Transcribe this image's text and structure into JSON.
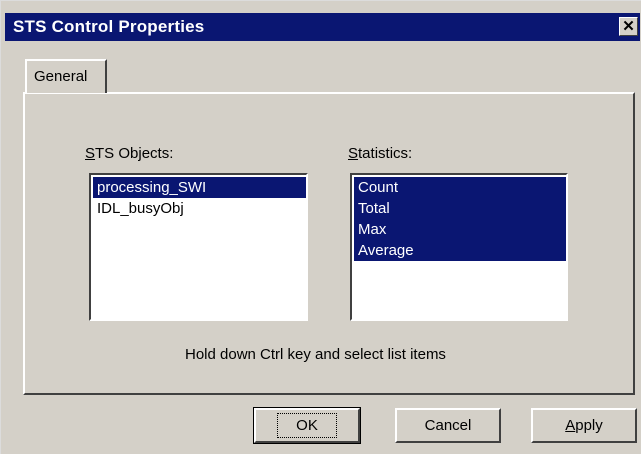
{
  "window": {
    "title": "STS Control Properties",
    "close_glyph": "✕"
  },
  "tabs": [
    {
      "label": "General",
      "active": true
    }
  ],
  "sts_objects": {
    "label": "STS Objects:",
    "label_accel": "S",
    "label_rest": "TS Objects:",
    "items": [
      {
        "label": "processing_SWI",
        "selected": true
      },
      {
        "label": "IDL_busyObj",
        "selected": false
      }
    ]
  },
  "statistics": {
    "label": "Statistics:",
    "label_accel": "S",
    "label_rest": "tatistics:",
    "items": [
      {
        "label": "Count",
        "selected": true
      },
      {
        "label": "Total",
        "selected": true
      },
      {
        "label": "Max",
        "selected": true
      },
      {
        "label": "Average",
        "selected": true
      }
    ]
  },
  "hint_text": "Hold down Ctrl key and select list items",
  "buttons": {
    "ok": "OK",
    "cancel": "Cancel",
    "apply_accel": "A",
    "apply_rest": "pply"
  },
  "colors": {
    "titlebar": "#0a1672",
    "selection": "#0a1672",
    "face": "#d4d0c8"
  }
}
